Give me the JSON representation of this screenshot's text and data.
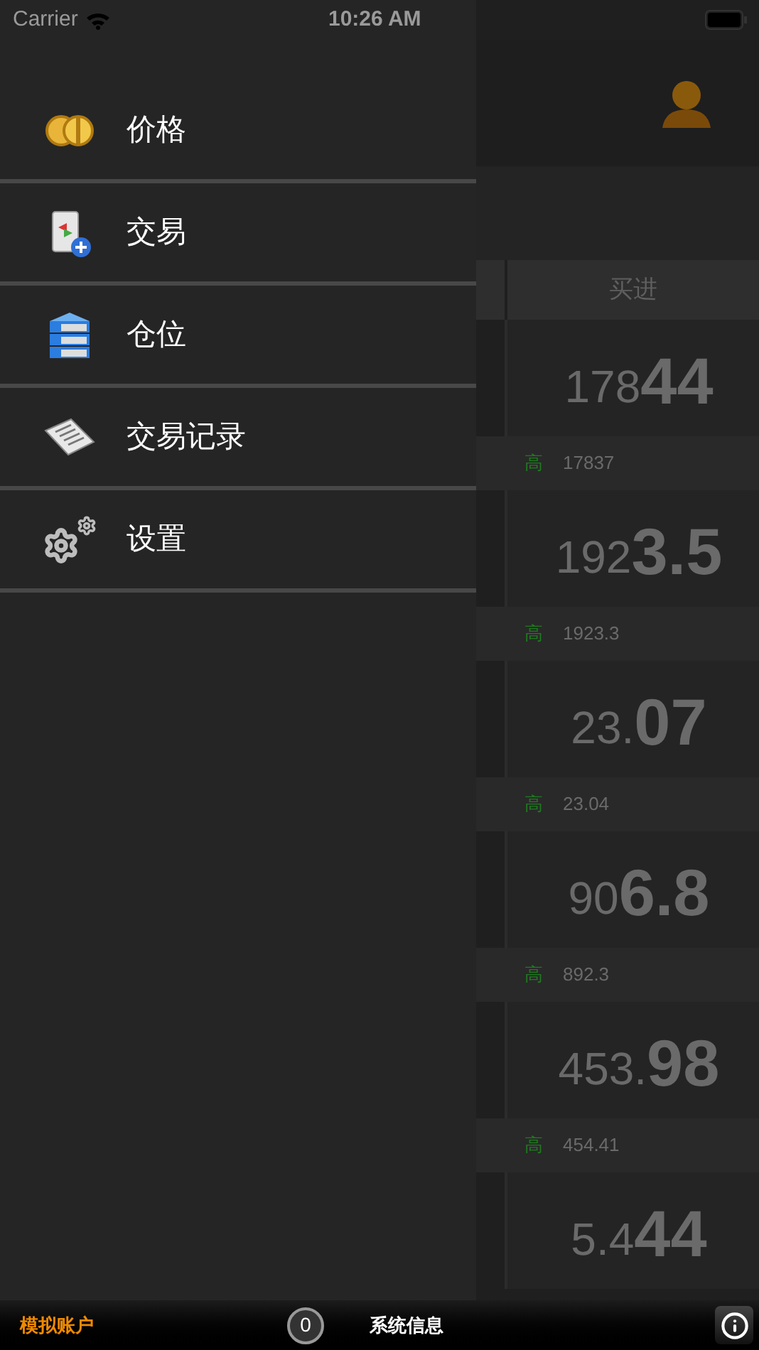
{
  "status_bar": {
    "carrier": "Carrier",
    "time": "10:26 AM"
  },
  "menu": {
    "items": [
      {
        "label": "价格"
      },
      {
        "label": "交易"
      },
      {
        "label": "仓位"
      },
      {
        "label": "交易记录"
      },
      {
        "label": "设置"
      }
    ]
  },
  "quotes": {
    "column_header": "买进",
    "rows": [
      {
        "price_prefix": "178",
        "price_main": "44",
        "high_label": "高",
        "high": "17837"
      },
      {
        "price_prefix": "192",
        "price_main": "3.5",
        "high_label": "高",
        "high": "1923.3"
      },
      {
        "price_prefix": "23.",
        "price_main": "07",
        "high_label": "高",
        "high": "23.04"
      },
      {
        "price_prefix": "90",
        "price_main": "6.8",
        "high_label": "高",
        "high": "892.3"
      },
      {
        "price_prefix": "453.",
        "price_main": "98",
        "high_label": "高",
        "high": "454.41"
      },
      {
        "price_prefix": "5.4",
        "price_main": "44"
      }
    ]
  },
  "bottom_bar": {
    "account": "模拟账户",
    "badge": "0",
    "system_info": "系统信息"
  }
}
